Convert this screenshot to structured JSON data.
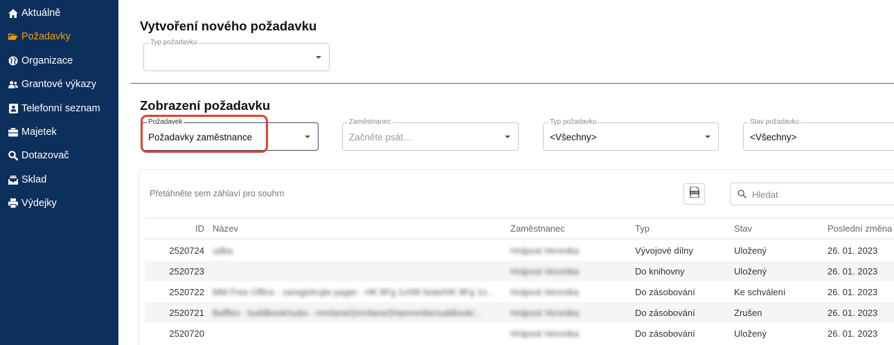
{
  "sidebar": {
    "items": [
      {
        "label": "Aktuálně",
        "icon": "home-icon",
        "active": false
      },
      {
        "label": "Požadavky",
        "icon": "folder-open-icon",
        "active": true
      },
      {
        "label": "Organizace",
        "icon": "globe-icon",
        "active": false
      },
      {
        "label": "Grantové výkazy",
        "icon": "users-icon",
        "active": false
      },
      {
        "label": "Telefonní seznam",
        "icon": "address-card-icon",
        "active": false
      },
      {
        "label": "Majetek",
        "icon": "briefcase-icon",
        "active": false
      },
      {
        "label": "Dotazovač",
        "icon": "search-icon",
        "active": false
      },
      {
        "label": "Sklad",
        "icon": "inbox-icon",
        "active": false
      },
      {
        "label": "Výdejky",
        "icon": "print-icon",
        "active": false
      }
    ]
  },
  "create": {
    "title": "Vytvoření nového požadavku",
    "type_field": {
      "label": "Typ požadavku",
      "value": ""
    }
  },
  "view": {
    "title": "Zobrazení požadavku",
    "filters": {
      "request": {
        "label": "Požadavek",
        "value": "Požadavky zaměstnance"
      },
      "employee": {
        "label": "Zaměstnanec",
        "placeholder": "Začněte psát..."
      },
      "type": {
        "label": "Typ požadavku",
        "value": "<Všechny>"
      },
      "state": {
        "label": "Stav požadavku",
        "value": "<Všechny>"
      }
    }
  },
  "grid": {
    "group_hint": "Přetáhněte sem záhlaví pro souhrn",
    "export_icon": "xlsx-export-icon",
    "search_placeholder": "Hledat",
    "columns": [
      "ID",
      "Název",
      "Zaměstnanec",
      "Typ",
      "Stav",
      "Poslední změna"
    ],
    "rows": [
      {
        "id": "2520724",
        "name": "udba",
        "employee": "Hrájová Veronika",
        "type": "Vývojové dílny",
        "state": "Uložený",
        "changed": "26. 01. 2023"
      },
      {
        "id": "2520723",
        "name": "",
        "employee": "Hrájová Veronika",
        "type": "Do knihovny",
        "state": "Uložený",
        "changed": "26. 01. 2023"
      },
      {
        "id": "2520722",
        "name": "MM Free Office - zaregistrujte pager - HK 8Fg 1v/08 Note/HK 8Fg 1v...",
        "employee": "Hrájová Veronika",
        "type": "Do zásobování",
        "state": "Ke schválení",
        "changed": "26. 01. 2023"
      },
      {
        "id": "2520721",
        "name": "Baffles - buildbook/subs - mn/tane/(mn/tane/(Hamrenbe/subBook/...",
        "employee": "Hrájová Veronika",
        "type": "Do zásobování",
        "state": "Zrušen",
        "changed": "26. 01. 2023"
      },
      {
        "id": "2520720",
        "name": "",
        "employee": "Hrájová Veronika",
        "type": "Do zásobování",
        "state": "Uložený",
        "changed": "26. 01. 2023"
      }
    ]
  },
  "colors": {
    "sidebar_bg": "#0d2f5b",
    "active_accent": "#f39c12",
    "highlight": "#d64532"
  }
}
